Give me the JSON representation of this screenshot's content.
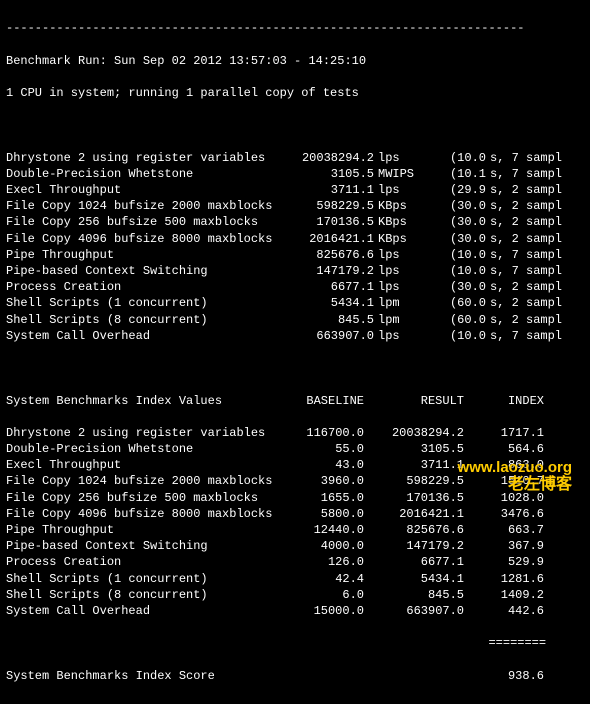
{
  "header": {
    "rule": "------------------------------------------------------------------------",
    "run_line": "Benchmark Run: Sun Sep 02 2012 13:57:03 - 14:25:10",
    "cpu_line": "1 CPU in system; running 1 parallel copy of tests"
  },
  "raw": [
    {
      "label": "Dhrystone 2 using register variables",
      "value": "20038294.2",
      "unit": "lps",
      "time": "(10.0",
      "trail": "s, 7 sampl"
    },
    {
      "label": "Double-Precision Whetstone",
      "value": "3105.5",
      "unit": "MWIPS",
      "time": "(10.1",
      "trail": "s, 7 sampl"
    },
    {
      "label": "Execl Throughput",
      "value": "3711.1",
      "unit": "lps",
      "time": "(29.9",
      "trail": "s, 2 sampl"
    },
    {
      "label": "File Copy 1024 bufsize 2000 maxblocks",
      "value": "598229.5",
      "unit": "KBps",
      "time": "(30.0",
      "trail": "s, 2 sampl"
    },
    {
      "label": "File Copy 256 bufsize 500 maxblocks",
      "value": "170136.5",
      "unit": "KBps",
      "time": "(30.0",
      "trail": "s, 2 sampl"
    },
    {
      "label": "File Copy 4096 bufsize 8000 maxblocks",
      "value": "2016421.1",
      "unit": "KBps",
      "time": "(30.0",
      "trail": "s, 2 sampl"
    },
    {
      "label": "Pipe Throughput",
      "value": "825676.6",
      "unit": "lps",
      "time": "(10.0",
      "trail": "s, 7 sampl"
    },
    {
      "label": "Pipe-based Context Switching",
      "value": "147179.2",
      "unit": "lps",
      "time": "(10.0",
      "trail": "s, 7 sampl"
    },
    {
      "label": "Process Creation",
      "value": "6677.1",
      "unit": "lps",
      "time": "(30.0",
      "trail": "s, 2 sampl"
    },
    {
      "label": "Shell Scripts (1 concurrent)",
      "value": "5434.1",
      "unit": "lpm",
      "time": "(60.0",
      "trail": "s, 2 sampl"
    },
    {
      "label": "Shell Scripts (8 concurrent)",
      "value": "845.5",
      "unit": "lpm",
      "time": "(60.0",
      "trail": "s, 2 sampl"
    },
    {
      "label": "System Call Overhead",
      "value": "663907.0",
      "unit": "lps",
      "time": "(10.0",
      "trail": "s, 7 sampl"
    }
  ],
  "index_header": {
    "title": "System Benchmarks Index Values",
    "c1": "BASELINE",
    "c2": "RESULT",
    "c3": "INDEX"
  },
  "index": [
    {
      "label": "Dhrystone 2 using register variables",
      "baseline": "116700.0",
      "result": "20038294.2",
      "index": "1717.1"
    },
    {
      "label": "Double-Precision Whetstone",
      "baseline": "55.0",
      "result": "3105.5",
      "index": "564.6"
    },
    {
      "label": "Execl Throughput",
      "baseline": "43.0",
      "result": "3711.1",
      "index": "863.0"
    },
    {
      "label": "File Copy 1024 bufsize 2000 maxblocks",
      "baseline": "3960.0",
      "result": "598229.5",
      "index": "1510.7"
    },
    {
      "label": "File Copy 256 bufsize 500 maxblocks",
      "baseline": "1655.0",
      "result": "170136.5",
      "index": "1028.0"
    },
    {
      "label": "File Copy 4096 bufsize 8000 maxblocks",
      "baseline": "5800.0",
      "result": "2016421.1",
      "index": "3476.6"
    },
    {
      "label": "Pipe Throughput",
      "baseline": "12440.0",
      "result": "825676.6",
      "index": "663.7"
    },
    {
      "label": "Pipe-based Context Switching",
      "baseline": "4000.0",
      "result": "147179.2",
      "index": "367.9"
    },
    {
      "label": "Process Creation",
      "baseline": "126.0",
      "result": "6677.1",
      "index": "529.9"
    },
    {
      "label": "Shell Scripts (1 concurrent)",
      "baseline": "42.4",
      "result": "5434.1",
      "index": "1281.6"
    },
    {
      "label": "Shell Scripts (8 concurrent)",
      "baseline": "6.0",
      "result": "845.5",
      "index": "1409.2"
    },
    {
      "label": "System Call Overhead",
      "baseline": "15000.0",
      "result": "663907.0",
      "index": "442.6"
    }
  ],
  "score": {
    "label": "System Benchmarks Index Score",
    "value": "938.6"
  },
  "footer_rule": "                                                                   ========",
  "watermark": {
    "url": "www.laozuo.org",
    "text": "老左博客"
  }
}
